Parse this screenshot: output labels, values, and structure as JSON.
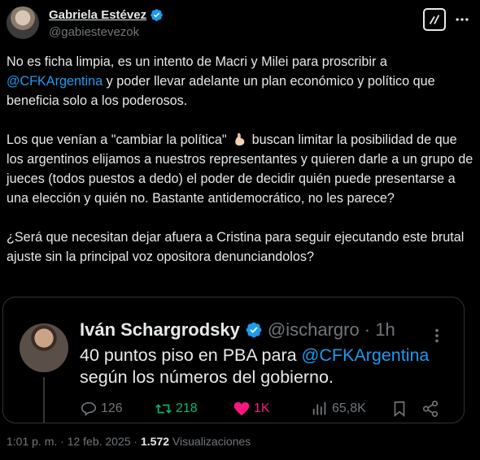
{
  "author": {
    "name": "Gabriela Estévez",
    "handle": "@gabiestevezok"
  },
  "tweet": {
    "p1_before": "No es ficha limpia, es un intento de Macri y Milei para proscribir a ",
    "p1_mention": "@CFKArgentina",
    "p1_after": " y poder llevar adelante un plan económico y político que beneficia solo a los poderosos.",
    "p2_before": "Los que venían a \"cambiar la política\" ",
    "p2_emoji": "pinched-fingers-emoji",
    "p2_after": " buscan limitar la posibilidad de que los argentinos elijamos a nuestros representantes y quieren darle a un grupo de jueces (todos puestos a dedo) el poder de decidir quién puede presentarse a una elección y quién no. Bastante antidemocrático, no les parece?",
    "p3": "¿Será que necesitan dejar afuera a Cristina para seguir ejecutando este brutal ajuste sin la principal voz opositora denunciandolos?"
  },
  "quote": {
    "name": "Iván Schargrodsky",
    "handle_time": "@ischargro · 1h",
    "text_before": "40 puntos piso en PBA para ",
    "text_mention": "@CFKArgentina",
    "text_after": " según los números del gobierno.",
    "replies": "126",
    "retweets": "218",
    "likes": "1K",
    "views": "65,8K"
  },
  "footer": {
    "timestamp": "1:01 p. m. · 12 feb. 2025 · ",
    "views_count": "1.572",
    "views_label": " Visualizaciones"
  },
  "colors": {
    "background": "#000000",
    "text": "#e7e9ea",
    "muted": "#71767b",
    "accent_blue": "#1d9bf0",
    "retweet_green": "#00ba7c",
    "like_pink": "#f91880"
  }
}
